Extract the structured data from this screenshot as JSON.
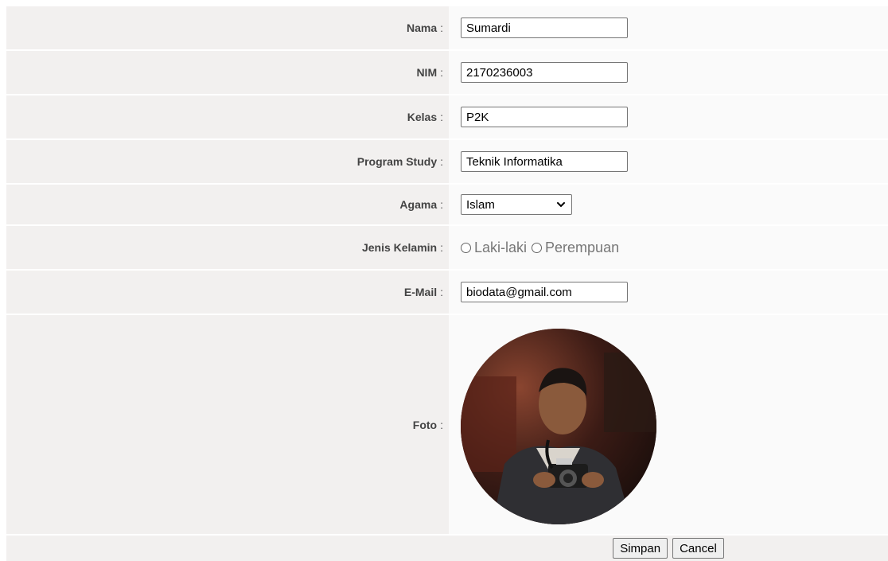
{
  "form": {
    "nama": {
      "label": "Nama",
      "value": "Sumardi"
    },
    "nim": {
      "label": "NIM",
      "value": "2170236003"
    },
    "kelas": {
      "label": "Kelas",
      "value": "P2K"
    },
    "prodi": {
      "label": "Program Study",
      "value": "Teknik Informatika"
    },
    "agama": {
      "label": "Agama",
      "selected": "Islam"
    },
    "gender": {
      "label": "Jenis Kelamin",
      "options": [
        "Laki-laki",
        "Perempuan"
      ]
    },
    "email": {
      "label": "E-Mail",
      "value": "biodata@gmail.com"
    },
    "foto": {
      "label": "Foto"
    },
    "colon": ":"
  },
  "buttons": {
    "save": "Simpan",
    "cancel": "Cancel"
  },
  "icons": {
    "select": "chevron-down-icon",
    "photo": "profile-photo"
  }
}
